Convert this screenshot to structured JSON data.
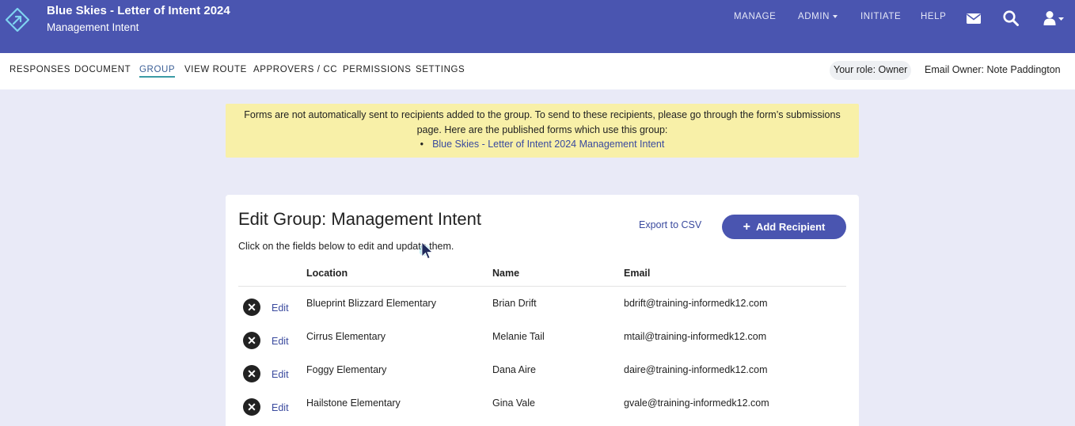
{
  "header": {
    "title": "Blue Skies - Letter of Intent 2024",
    "subtitle": "Management Intent",
    "nav": [
      "MANAGE",
      "ADMIN",
      "INITIATE",
      "HELP"
    ],
    "icons": [
      "envelope-icon",
      "search-icon",
      "user-icon"
    ]
  },
  "tabs": [
    {
      "label": "RESPONSES"
    },
    {
      "label": "DOCUMENT"
    },
    {
      "label": "GROUP",
      "active": true
    },
    {
      "label": "VIEW ROUTE"
    },
    {
      "label": "APPROVERS / CC"
    },
    {
      "label": "PERMISSIONS"
    },
    {
      "label": "SETTINGS"
    }
  ],
  "role": "Your role: Owner",
  "email_owner": "Email Owner: Note Paddington",
  "notice": {
    "line1": "Forms are not automatically sent to recipients added to the group. To send to these recipients, please go through the form’s submissions",
    "line2": "page. Here are the published forms which use this group:",
    "link": "Blue Skies - Letter of Intent 2024 Management Intent"
  },
  "card": {
    "title": "Edit Group: Management Intent",
    "description": "Click on the fields below to edit and update them.",
    "export_label": "Export to CSV",
    "add_label": "Add Recipient",
    "columns": [
      "Location",
      "Name",
      "Email"
    ],
    "edit_label": "Edit",
    "rows": [
      {
        "location": "Blueprint Blizzard Elementary",
        "name": "Brian Drift",
        "email": "bdrift@training-informedk12.com"
      },
      {
        "location": "Cirrus Elementary",
        "name": "Melanie Tail",
        "email": "mtail@training-informedk12.com"
      },
      {
        "location": "Foggy Elementary",
        "name": "Dana Aire",
        "email": "daire@training-informedk12.com"
      },
      {
        "location": "Hailstone Elementary",
        "name": "Gina Vale",
        "email": "gvale@training-informedk12.com"
      }
    ]
  },
  "colors": {
    "header_bg": "#4a55b0",
    "page_bg": "#e9eaf7",
    "notice_bg": "#f8f0a8",
    "link": "#3a4a9e",
    "active_tab_underline": "#3b9ba5"
  }
}
